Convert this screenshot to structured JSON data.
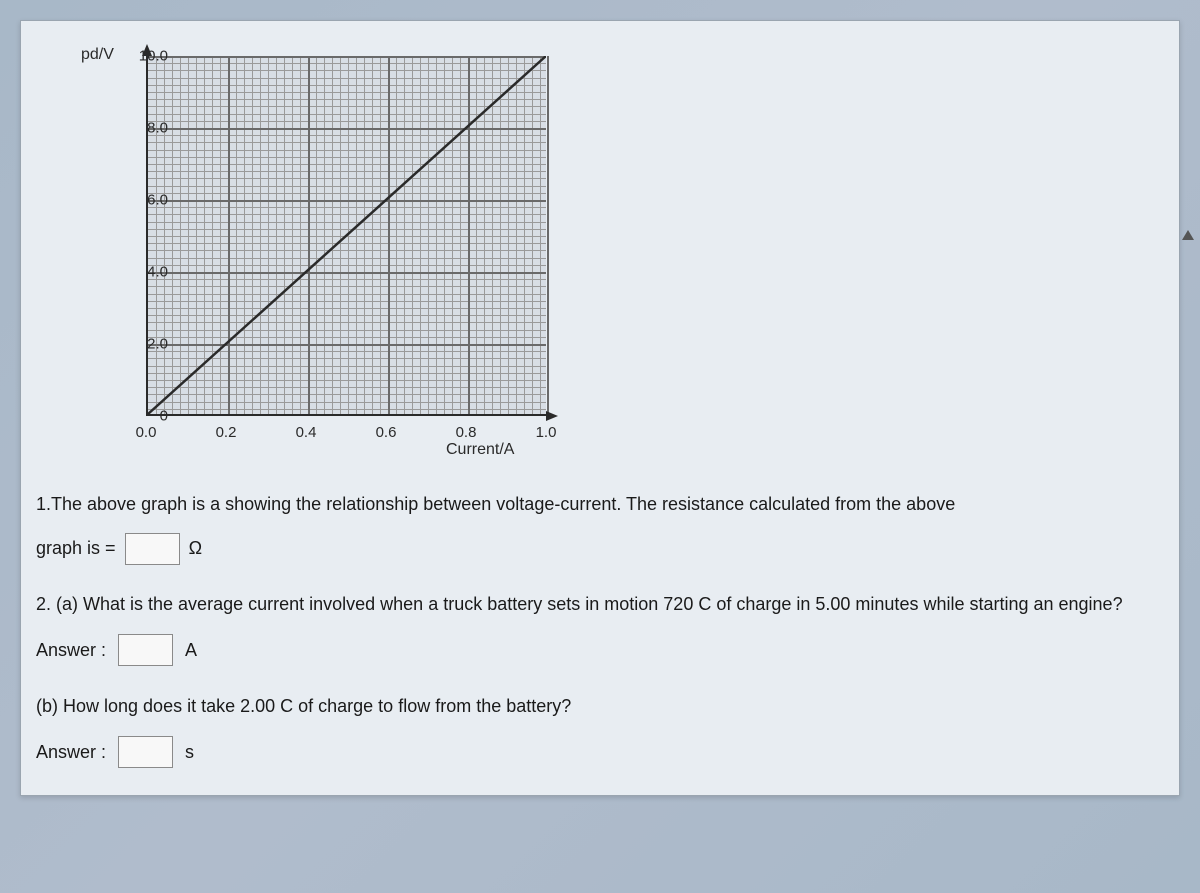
{
  "chart_data": {
    "type": "line",
    "x": [
      0.0,
      0.2,
      0.4,
      0.6,
      0.8,
      1.0
    ],
    "y": [
      0,
      2.0,
      4.0,
      6.0,
      8.0,
      10.0
    ],
    "title": "",
    "xlabel": "Current/A",
    "ylabel": "pd/V",
    "xlim": [
      0.0,
      1.0
    ],
    "ylim": [
      0,
      10.0
    ],
    "xticks": [
      "0.0",
      "0.2",
      "0.4",
      "0.6",
      "0.8",
      "1.0"
    ],
    "yticks": [
      "0",
      "2.0",
      "4.0",
      "6.0",
      "8.0",
      "10.0"
    ]
  },
  "questions": {
    "q1": {
      "text_a": "1.The above graph is a showing the relationship between voltage-current. The resistance calculated from the above",
      "text_b": "graph is =",
      "unit": "Ω"
    },
    "q2a": {
      "text": "2. (a) What is the average current involved when a truck battery sets in motion 720 C of charge in 5.00 minutes while starting an engine?",
      "answer_label": "Answer :",
      "unit": "A"
    },
    "q2b": {
      "text": "(b) How long does it take 2.00 C of charge to flow from the battery?",
      "answer_label": "Answer :",
      "unit": "s"
    }
  }
}
